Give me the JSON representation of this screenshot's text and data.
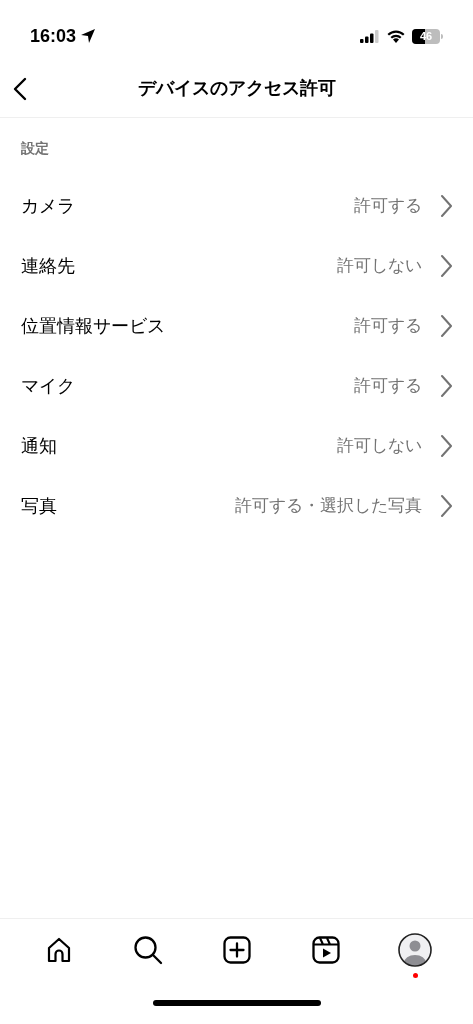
{
  "status_bar": {
    "time": "16:03",
    "battery": "46"
  },
  "header": {
    "title": "デバイスのアクセス許可"
  },
  "section": {
    "title": "設定"
  },
  "rows": [
    {
      "label": "カメラ",
      "value": "許可する"
    },
    {
      "label": "連絡先",
      "value": "許可しない"
    },
    {
      "label": "位置情報サービス",
      "value": "許可する"
    },
    {
      "label": "マイク",
      "value": "許可する"
    },
    {
      "label": "通知",
      "value": "許可しない"
    },
    {
      "label": "写真",
      "value": "許可する・選択した写真"
    }
  ],
  "tab_bar": [
    {
      "kind": "home",
      "badge": false
    },
    {
      "kind": "search",
      "badge": false
    },
    {
      "kind": "create",
      "badge": false
    },
    {
      "kind": "reels",
      "badge": false
    },
    {
      "kind": "profile",
      "badge": true
    }
  ]
}
